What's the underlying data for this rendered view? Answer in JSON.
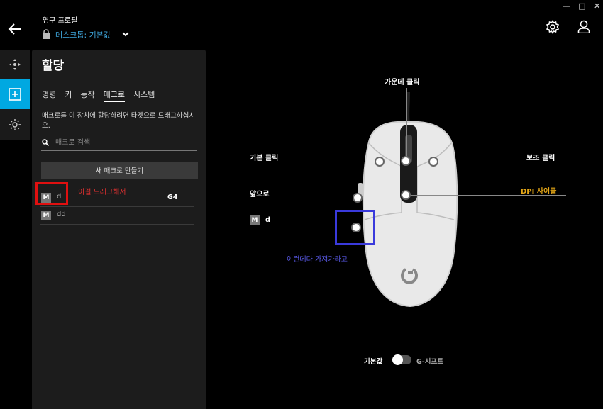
{
  "window": {
    "minimize": "—",
    "maximize": "□",
    "close": "✕"
  },
  "header": {
    "profile_title": "영구 프로필",
    "profile_name": "데스크톱: 기본값"
  },
  "panel": {
    "title": "할당",
    "tabs": [
      "명령",
      "키",
      "동작",
      "매크로",
      "시스템"
    ],
    "active_tab": "매크로",
    "hint": "매크로를 이 장치에 할당하려면 타겟으로 드래그하십시오.",
    "search_placeholder": "매크로 검색",
    "create_button": "새 매크로 만들기",
    "macros": [
      {
        "badge": "M",
        "name": "d"
      },
      {
        "badge": "M",
        "name": "dd"
      }
    ],
    "annotation_red": "이걸 드래그해서",
    "assigned_key": "G4"
  },
  "mouse": {
    "middle_click": "가운데 클릭",
    "primary_click": "기본 클릭",
    "secondary_click": "보조 클릭",
    "forward": "앞으로",
    "dpi_cycle": "DPI 사이클",
    "macro_badge": "M",
    "macro_label": "d",
    "annotation_blue": "이런데다 가져가라고",
    "dpi_color": "#e6a817"
  },
  "toggle": {
    "left_label": "기본값",
    "right_label": "G-시프트"
  }
}
